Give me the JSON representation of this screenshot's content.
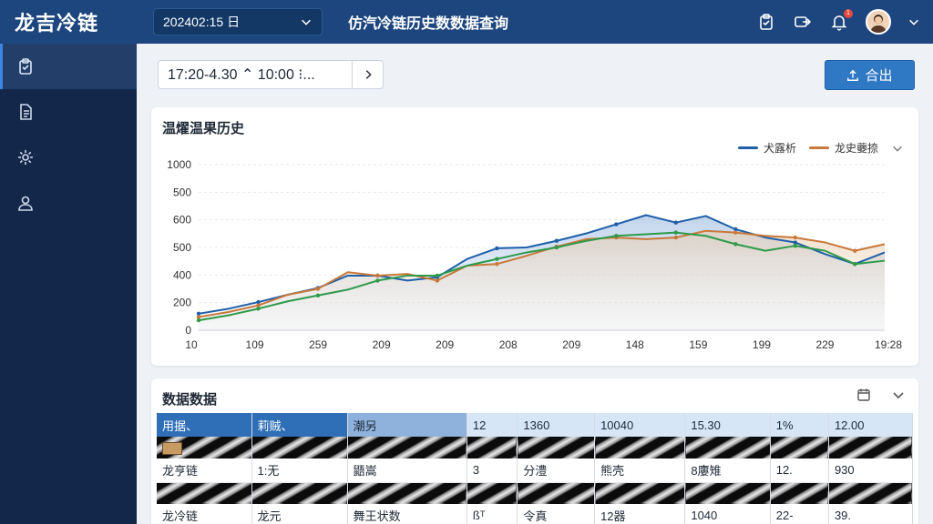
{
  "app": {
    "brand": "龙吉冷链",
    "date_value": "202402:15 日",
    "page_title": "仿汽冷链历史数数据查询"
  },
  "header_icons": [
    "clipboard-icon",
    "export-arrow-icon",
    "bell-icon",
    "avatar",
    "chevron-down-icon"
  ],
  "notification_badge": "1",
  "sidebar": {
    "items": [
      {
        "icon": "clipboard-check-icon",
        "active": true
      },
      {
        "icon": "document-icon",
        "active": false
      },
      {
        "icon": "gear-icon",
        "active": false
      },
      {
        "icon": "user-icon",
        "active": false
      }
    ]
  },
  "toolbar": {
    "range_text": "17:20-4.30 ⌃ 10:00 ⁝...",
    "export_label": "合出"
  },
  "colors": {
    "series1": "#1f5fa8",
    "series2": "#c9783a",
    "series3": "#2e9a4a",
    "accent": "#2f78c4"
  },
  "chart_card": {
    "title": "温燿温果历史"
  },
  "chart_data": {
    "type": "line",
    "title": "温燿温果历史",
    "xlabel": "",
    "ylabel": "",
    "x_ticks": [
      "10",
      "109",
      "259",
      "209",
      "209",
      "208",
      "209",
      "148",
      "159",
      "199",
      "229",
      "19:28"
    ],
    "y_ticks": [
      0,
      200,
      400,
      500,
      600,
      500,
      1000
    ],
    "ylim": [
      0,
      1000
    ],
    "grid": true,
    "legend_position": "top-right",
    "series": [
      {
        "name": "犬露析",
        "color": "#1f5fa8",
        "values": [
          100,
          130,
          170,
          215,
          255,
          330,
          330,
          300,
          320,
          430,
          495,
          500,
          540,
          585,
          640,
          695,
          650,
          690,
          610,
          560,
          530,
          460,
          400,
          470
        ]
      },
      {
        "name": "龙史虁捺",
        "color": "#c9783a",
        "values": [
          80,
          110,
          150,
          215,
          250,
          350,
          330,
          340,
          300,
          390,
          400,
          450,
          505,
          550,
          560,
          550,
          560,
          600,
          590,
          570,
          560,
          530,
          480,
          520
        ]
      },
      {
        "name": "",
        "color": "#2e9a4a",
        "values": [
          60,
          90,
          130,
          175,
          210,
          245,
          300,
          330,
          330,
          390,
          430,
          470,
          500,
          540,
          570,
          580,
          590,
          570,
          520,
          480,
          510,
          480,
          400,
          420
        ]
      }
    ]
  },
  "table_card": {
    "title": "数据数据",
    "columns": [
      "用据、",
      "莉贼、",
      "潮另",
      "12",
      "1360",
      "10040",
      "15.30",
      "1%",
      "12.00"
    ],
    "rows": [
      [
        "龙亨链",
        "1:无",
        "鼯嵩",
        "3",
        "分澧",
        "熊壳",
        "8廔雉",
        "12.",
        "930"
      ],
      [
        "龙冷链",
        "龙元",
        "舞王状数",
        "ßᵀ",
        "令真",
        "12器",
        "1040",
        "22-",
        "39."
      ]
    ]
  }
}
